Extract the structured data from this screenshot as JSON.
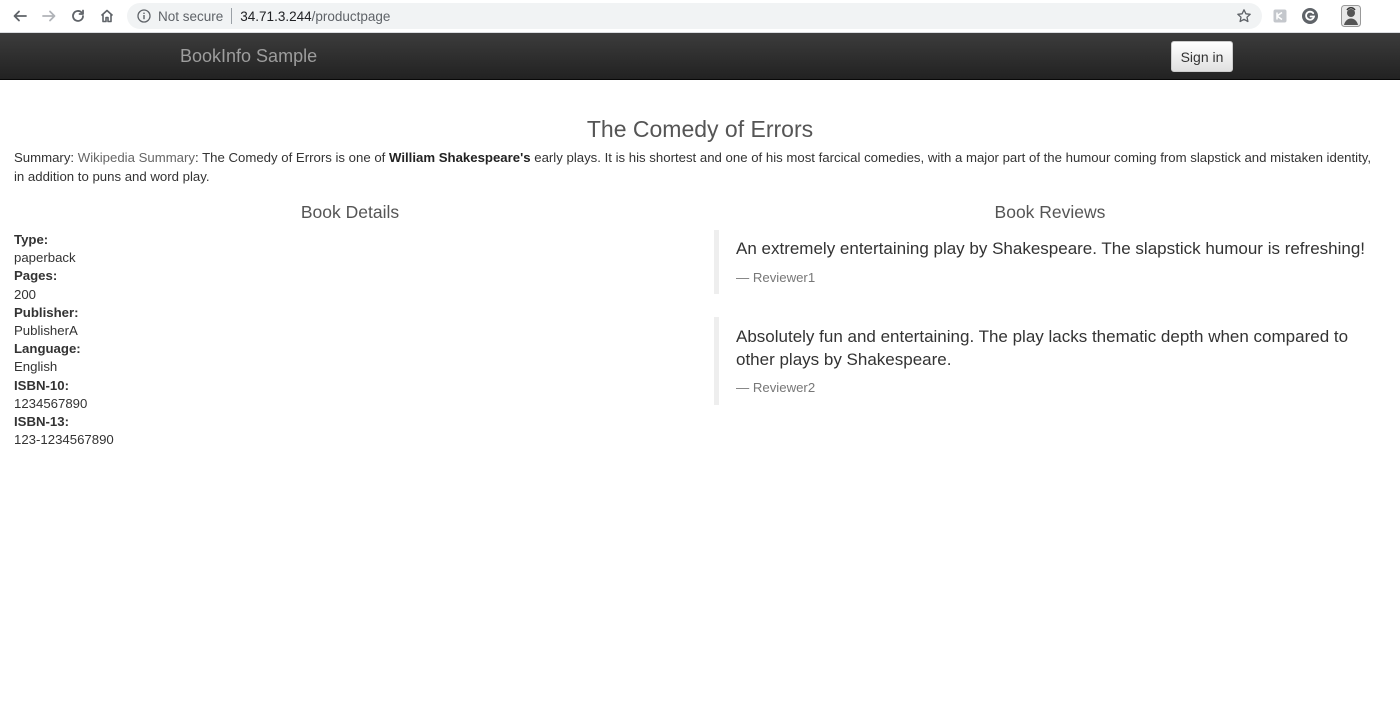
{
  "browser": {
    "security_label": "Not secure",
    "url_host": "34.71.3.244",
    "url_path": "/productpage"
  },
  "navbar": {
    "brand": "BookInfo Sample",
    "signin_label": "Sign in"
  },
  "book": {
    "title": "The Comedy of Errors",
    "summary": {
      "prefix": "Summary: ",
      "link_text": "Wikipedia Summary",
      "text_before_bold": ": The Comedy of Errors is one of ",
      "bold_text": "William Shakespeare's",
      "text_after_bold": " early plays. It is his shortest and one of his most farcical comedies, with a major part of the humour coming from slapstick and mistaken identity, in addition to puns and word play."
    }
  },
  "details": {
    "heading": "Book Details",
    "fields": [
      {
        "label": "Type:",
        "value": "paperback"
      },
      {
        "label": "Pages:",
        "value": "200"
      },
      {
        "label": "Publisher:",
        "value": "PublisherA"
      },
      {
        "label": "Language:",
        "value": "English"
      },
      {
        "label": "ISBN-10:",
        "value": "1234567890"
      },
      {
        "label": "ISBN-13:",
        "value": "123-1234567890"
      }
    ]
  },
  "reviews": {
    "heading": "Book Reviews",
    "items": [
      {
        "text": "An extremely entertaining play by Shakespeare. The slapstick humour is refreshing!",
        "reviewer": "— Reviewer1"
      },
      {
        "text": "Absolutely fun and entertaining. The play lacks thematic depth when compared to other plays by Shakespeare.",
        "reviewer": "— Reviewer2"
      }
    ]
  },
  "icons": {
    "back": "back-arrow-icon",
    "forward": "forward-arrow-icon",
    "reload": "reload-icon",
    "home": "home-icon",
    "info": "info-icon",
    "bookmark": "star-icon",
    "extension1": "extension-icon",
    "extension2": "grammarly-icon",
    "profile": "profile-avatar-icon"
  },
  "colors": {
    "navbar_top": "#3c3c3c",
    "navbar_bottom": "#222222",
    "brand_text": "#9d9d9d",
    "heading_text": "#555555",
    "link_text": "#666666",
    "review_border": "#eeeeee"
  }
}
